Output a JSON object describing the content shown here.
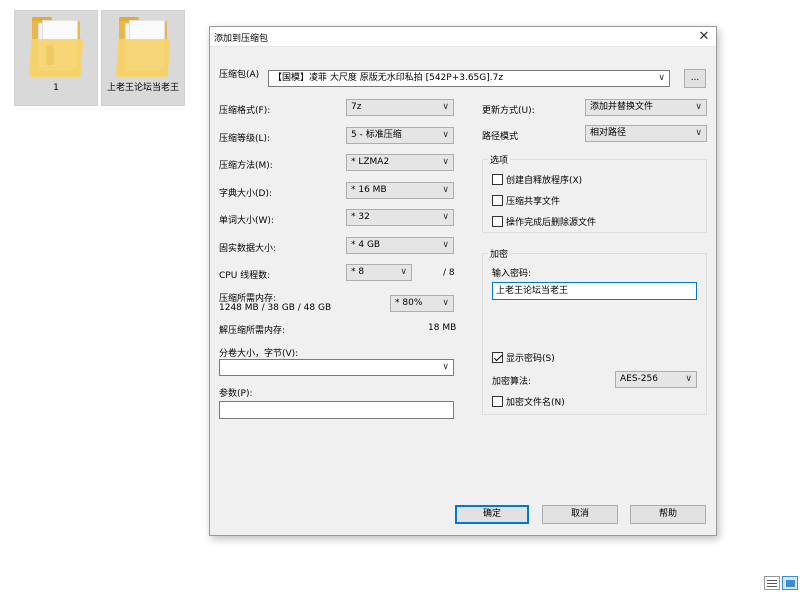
{
  "folders": [
    {
      "label": "1"
    },
    {
      "label": "上老王论坛当老王"
    }
  ],
  "dialog": {
    "title": "添加到压缩包",
    "close_glyph": "✕",
    "archive_label": "压缩包(A)",
    "archive_value": "【国模】凌菲 大尺度 原版无水印私拍 [542P+3.65G].7z",
    "browse_label": "...",
    "format_label": "压缩格式(F):",
    "format_value": "7z",
    "level_label": "压缩等级(L):",
    "level_value": "5 - 标准压缩",
    "method_label": "压缩方法(M):",
    "method_value": "* LZMA2",
    "dict_label": "字典大小(D):",
    "dict_value": "* 16 MB",
    "word_label": "单词大小(W):",
    "word_value": "* 32",
    "solid_label": "固实数据大小:",
    "solid_value": "* 4 GB",
    "cpu_label": "CPU 线程数:",
    "cpu_value": "* 8",
    "cpu_total": "/ 8",
    "mem_label": "压缩所需内存:",
    "mem_value": "1248 MB / 38 GB / 48 GB",
    "mem_percent": "* 80%",
    "decomp_label": "解压缩所需内存:",
    "decomp_value": "18 MB",
    "split_label": "分卷大小，字节(V):",
    "split_value": "",
    "params_label": "参数(P):",
    "params_value": "",
    "update_label": "更新方式(U):",
    "update_value": "添加并替换文件",
    "path_label": "路径模式",
    "path_value": "相对路径",
    "options_title": "选项",
    "opt_sfx": "创建自释放程序(X)",
    "opt_shared": "压缩共享文件",
    "opt_delete": "操作完成后删除源文件",
    "encrypt_title": "加密",
    "password_label": "输入密码:",
    "password_value": "上老王论坛当老王",
    "show_password": "显示密码(S)",
    "enc_method_label": "加密算法:",
    "enc_method_value": "AES-256",
    "enc_names": "加密文件名(N)",
    "ok_label": "确定",
    "cancel_label": "取消",
    "help_label": "帮助",
    "arrow": "∨"
  },
  "icons": {
    "details_view": "details-view-icon",
    "large_icons_view": "large-icons-view-icon"
  }
}
